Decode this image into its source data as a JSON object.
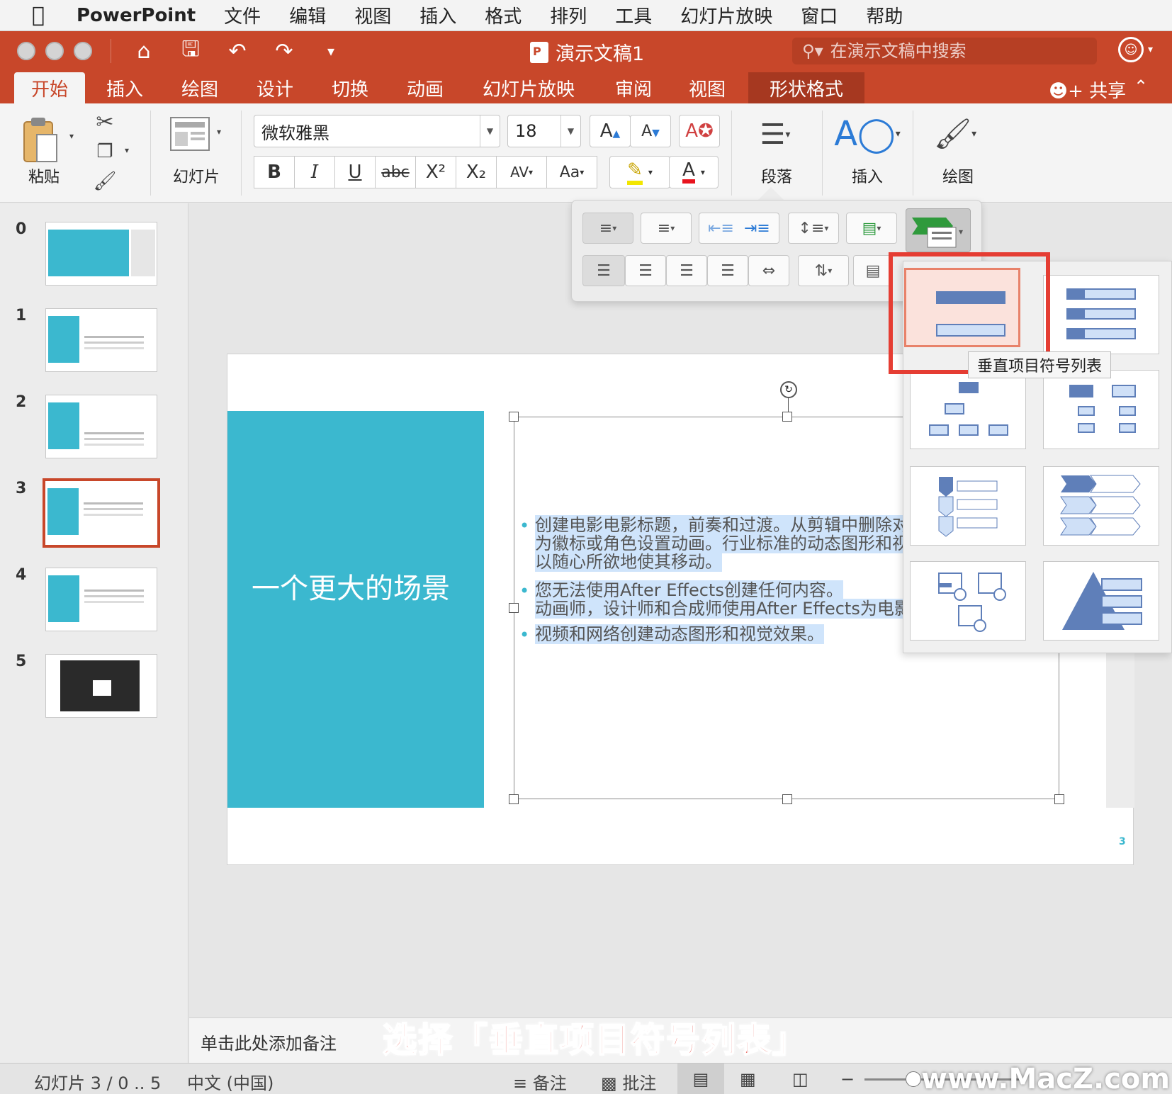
{
  "menubar": {
    "app_name": "PowerPoint",
    "items": [
      "文件",
      "编辑",
      "视图",
      "插入",
      "格式",
      "排列",
      "工具",
      "幻灯片放映",
      "窗口",
      "帮助"
    ]
  },
  "titlebar": {
    "doc_title": "演示文稿1",
    "search_placeholder": "在演示文稿中搜索"
  },
  "tabs": {
    "items": [
      "开始",
      "插入",
      "绘图",
      "设计",
      "切换",
      "动画",
      "幻灯片放映",
      "审阅",
      "视图",
      "形状格式"
    ],
    "active": "开始",
    "share_label": "共享"
  },
  "ribbon": {
    "paste_label": "粘贴",
    "slides_label": "幻灯片",
    "font_name": "微软雅黑",
    "font_size": "18",
    "paragraph_label": "段落",
    "insert_label": "插入",
    "drawing_label": "绘图",
    "bold": "B",
    "italic": "I",
    "underline": "U",
    "strike": "abc",
    "superscript": "X²",
    "subscript": "X₂",
    "spacing": "AV",
    "change_case": "Aa",
    "font_color_letter": "A"
  },
  "thumbnails": {
    "numbers": [
      "0",
      "1",
      "2",
      "3",
      "4",
      "5"
    ],
    "selected": "3"
  },
  "slide": {
    "title": "一个更大的场景",
    "bullets": [
      [
        "创建电影电影标题，前奏和过渡。从剪辑中删除对",
        "为徽标或角色设置动画。行业标准的动态图形和视",
        "以随心所欲地使其移动。"
      ],
      [
        "您无法使用After Effects创建任何内容。",
        "动画师，设计师和合成师使用After Effects为电影"
      ],
      [
        "视频和网络创建动态图形和视觉效果。"
      ]
    ],
    "page_number": "3"
  },
  "smartart": {
    "tooltip": "垂直项目符号列表"
  },
  "notes": {
    "placeholder": "单击此处添加备注",
    "caption": "选择「垂直项目符号列表」"
  },
  "statusbar": {
    "slide_info": "幻灯片 3 / 0 .. 5",
    "language": "中文 (中国)",
    "notes_label": "备注",
    "comments_label": "批注",
    "watermark": "www.MacZ.com"
  },
  "colors": {
    "accent": "#c8472a",
    "teal": "#3bb8cf",
    "highlight_red": "#e53d33",
    "smartart_blue": "#5f7fb9"
  }
}
